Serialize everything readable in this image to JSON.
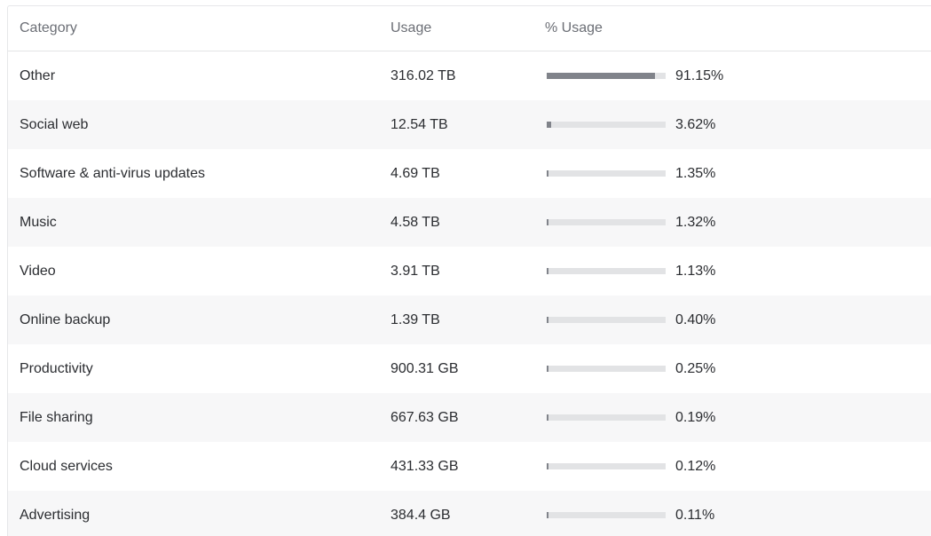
{
  "table": {
    "headers": {
      "category": "Category",
      "usage": "Usage",
      "percent": "% Usage"
    },
    "rows": [
      {
        "category": "Other",
        "usage": "316.02 TB",
        "percent_text": "91.15%",
        "percent": 91.15
      },
      {
        "category": "Social web",
        "usage": "12.54 TB",
        "percent_text": "3.62%",
        "percent": 3.62
      },
      {
        "category": "Software & anti-virus updates",
        "usage": "4.69 TB",
        "percent_text": "1.35%",
        "percent": 1.35
      },
      {
        "category": "Music",
        "usage": "4.58 TB",
        "percent_text": "1.32%",
        "percent": 1.32
      },
      {
        "category": "Video",
        "usage": "3.91 TB",
        "percent_text": "1.13%",
        "percent": 1.13
      },
      {
        "category": "Online backup",
        "usage": "1.39 TB",
        "percent_text": "0.40%",
        "percent": 0.4
      },
      {
        "category": "Productivity",
        "usage": "900.31 GB",
        "percent_text": "0.25%",
        "percent": 0.25
      },
      {
        "category": "File sharing",
        "usage": "667.63 GB",
        "percent_text": "0.19%",
        "percent": 0.19
      },
      {
        "category": "Cloud services",
        "usage": "431.33 GB",
        "percent_text": "0.12%",
        "percent": 0.12
      },
      {
        "category": "Advertising",
        "usage": "384.4 GB",
        "percent_text": "0.11%",
        "percent": 0.11
      }
    ]
  },
  "colors": {
    "bar_fill": "#80838a",
    "bar_track": "#e2e3e5",
    "row_alt": "#f7f7f8"
  }
}
